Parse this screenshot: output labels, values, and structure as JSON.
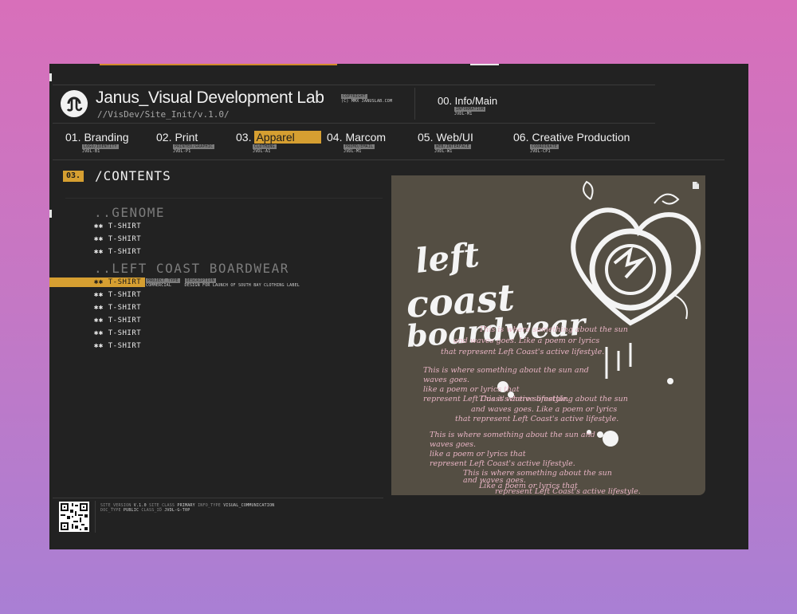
{
  "header": {
    "site_title": "Janus_Visual Development Lab",
    "site_path": "//VisDev/Site_Init/v.1.0/",
    "copyright_tag": "COPYRIGHT",
    "copyright_text": "(C) MMX JANUSLAB.COM",
    "info_title": "00. Info/Main",
    "info_tag": "INFORMATION",
    "info_code": "JVDL-M1"
  },
  "nav": [
    {
      "number": "01.",
      "label": "Branding",
      "tag": "LOGO/IDENTITY",
      "code": "JVDL-B1",
      "active": false
    },
    {
      "number": "02.",
      "label": "Print",
      "tag": "PRINTED/GRAPHIC",
      "code": "JVDL-P1",
      "active": false
    },
    {
      "number": "03.",
      "label": "Apparel",
      "tag": "CLOTHING",
      "code": "JVDL-A1",
      "active": true
    },
    {
      "number": "04.",
      "label": "Marcom",
      "tag": "PROMO/EMAIL",
      "code": "JVDL-M1",
      "active": false
    },
    {
      "number": "05.",
      "label": "Web/UI",
      "tag": "WEB/INTERFACE",
      "code": "JVDL-W1",
      "active": false
    },
    {
      "number": "06.",
      "label": "Creative Production",
      "tag": "COORDINATE",
      "code": "JVDL-CP1",
      "active": false
    }
  ],
  "contents": {
    "section_number": "03.",
    "section_title": "/CONTENTS",
    "groups": [
      {
        "title": "..GENOME",
        "items": [
          "✱✱ T-SHIRT",
          "✱✱ T-SHIRT",
          "✱✱ T-SHIRT"
        ]
      },
      {
        "title": "..LEFT COAST BOARDWEAR",
        "items": [
          "✱✱ T-SHIRT",
          "✱✱ T-SHIRT",
          "✱✱ T-SHIRT",
          "✱✱ T-SHIRT",
          "✱✱ T-SHIRT",
          "✱✱ T-SHIRT"
        ]
      }
    ],
    "selected_meta": {
      "project_type_tag": "PROJECT_TYPE",
      "project_type": "COMMERCIAL",
      "description_tag": "DESCRIPTION",
      "description": "DESIGN FOR LAUNCH OF SOUTH BAY CLOTHING LABEL"
    }
  },
  "preview": {
    "art_title_lines": [
      "left",
      "coast",
      "boardwear"
    ],
    "script_lines": [
      "This is where something about the sun",
      "and waves goes. Like a poem or lyrics",
      "that represent Left Coast's active lifestyle.",
      "This is where something about the sun and",
      "waves goes.",
      "like a poem or lyrics that",
      "represent Left Coast's active lifestyle.",
      "This is where something about the sun",
      "and waves goes. Like a poem or lyrics",
      "that represent Left Coast's active lifestyle.",
      "This is where something about the sun and",
      "waves goes.",
      "like a poem or lyrics that",
      "represent Left Coast's active lifestyle.",
      "This is where something about the sun",
      "and waves goes.",
      "Like a poem or lyrics that",
      "represent Left Coast's active lifestyle."
    ]
  },
  "footer": {
    "site_version_label": "SITE_VERSION",
    "site_version": "V.1.0",
    "site_class_label": "SITE_CLASS",
    "site_class": "PRIMARY",
    "info_type_label": "INFO_TYPE",
    "info_type": "VISUAL_COMMUNICATION",
    "doc_type_label": "DOC_TYPE",
    "doc_type": "PUBLIC",
    "class_id_label": "CLASS_ID",
    "class_id": "JVDL-G-T0P"
  },
  "colors": {
    "accent": "#d69f31",
    "screen_bg": "#222222",
    "preview_bg": "#544e43",
    "art_pink": "#e8b4c4"
  }
}
